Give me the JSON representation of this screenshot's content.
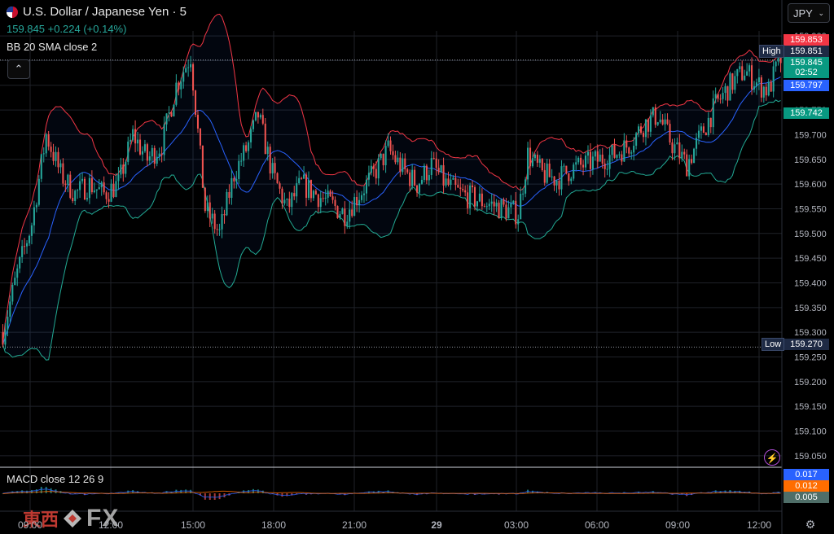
{
  "header": {
    "symbol_title": "U.S. Dollar / Japanese Yen · 5",
    "price_change": "159.845 +0.224 (+0.14%)",
    "indicator_bb": "BB 20 SMA close 2",
    "indicator_macd": "MACD close 12 26 9",
    "currency_select": "JPY"
  },
  "right_axis": {
    "high_tag": "High",
    "low_tag": "Low",
    "badge_upper": "159.853",
    "badge_high": "159.851",
    "badge_last": "159.845",
    "badge_countdown": "02:52",
    "badge_basis": "159.797",
    "badge_lower": "159.742",
    "badge_low": "159.270",
    "macd_badge_1": "0.017",
    "macd_badge_2": "0.012",
    "macd_badge_3": "0.005"
  },
  "time_axis": [
    "09:00",
    "12:00",
    "15:00",
    "18:00",
    "21:00",
    "29",
    "03:00",
    "06:00",
    "09:00",
    "12:00"
  ],
  "watermark": {
    "cjk": "東西",
    "fx": "FX"
  },
  "colors": {
    "up": "#26a69a",
    "down": "#ef5350",
    "upper_band": "#f23645",
    "basis": "#2962ff",
    "lower_band": "#22ab94",
    "background": "#000000"
  },
  "chart_data": [
    {
      "type": "candlestick",
      "title": "U.S. Dollar / Japanese Yen · 5",
      "ylim": [
        159.03,
        159.91
      ],
      "y_ticks": [
        159.05,
        159.1,
        159.15,
        159.2,
        159.25,
        159.3,
        159.35,
        159.4,
        159.45,
        159.5,
        159.55,
        159.6,
        159.65,
        159.7,
        159.75,
        159.8,
        159.85,
        159.9
      ],
      "x_tick_labels": [
        "09:00",
        "12:00",
        "15:00",
        "18:00",
        "21:00",
        "29",
        "03:00",
        "06:00",
        "09:00",
        "12:00"
      ],
      "grid": true,
      "price_path_anchors": [
        [
          0,
          159.3
        ],
        [
          6,
          159.42
        ],
        [
          12,
          159.52
        ],
        [
          18,
          159.7
        ],
        [
          24,
          159.62
        ],
        [
          30,
          159.58
        ],
        [
          36,
          159.6
        ],
        [
          42,
          159.58
        ],
        [
          48,
          159.6
        ],
        [
          54,
          159.7
        ],
        [
          60,
          159.65
        ],
        [
          66,
          159.68
        ],
        [
          72,
          159.8
        ],
        [
          78,
          159.86
        ],
        [
          84,
          159.55
        ],
        [
          90,
          159.5
        ],
        [
          96,
          159.62
        ],
        [
          102,
          159.68
        ],
        [
          106,
          159.74
        ],
        [
          112,
          159.62
        ],
        [
          118,
          159.55
        ],
        [
          124,
          159.6
        ],
        [
          130,
          159.58
        ],
        [
          136,
          159.56
        ],
        [
          142,
          159.54
        ],
        [
          148,
          159.58
        ],
        [
          154,
          159.62
        ],
        [
          160,
          159.67
        ],
        [
          166,
          159.63
        ],
        [
          172,
          159.6
        ],
        [
          178,
          159.64
        ],
        [
          184,
          159.6
        ],
        [
          190,
          159.58
        ],
        [
          196,
          159.57
        ],
        [
          202,
          159.56
        ],
        [
          208,
          159.55
        ],
        [
          214,
          159.54
        ],
        [
          218,
          159.66
        ],
        [
          224,
          159.62
        ],
        [
          230,
          159.61
        ],
        [
          236,
          159.63
        ],
        [
          242,
          159.64
        ],
        [
          248,
          159.65
        ],
        [
          254,
          159.66
        ],
        [
          260,
          159.68
        ],
        [
          266,
          159.72
        ],
        [
          272,
          159.74
        ],
        [
          278,
          159.68
        ],
        [
          284,
          159.64
        ],
        [
          290,
          159.7
        ],
        [
          296,
          159.76
        ],
        [
          302,
          159.8
        ],
        [
          308,
          159.83
        ],
        [
          314,
          159.8
        ],
        [
          318,
          159.79
        ],
        [
          322,
          159.845
        ]
      ],
      "bollinger": {
        "period": 20,
        "stddev": 2,
        "source": "close"
      },
      "series": [
        {
          "name": "BB 20 SMA close 2"
        }
      ]
    },
    {
      "type": "histogram",
      "title": "MACD close 12 26 9",
      "values_latest": [
        0.017,
        0.012,
        0.005
      ]
    }
  ]
}
